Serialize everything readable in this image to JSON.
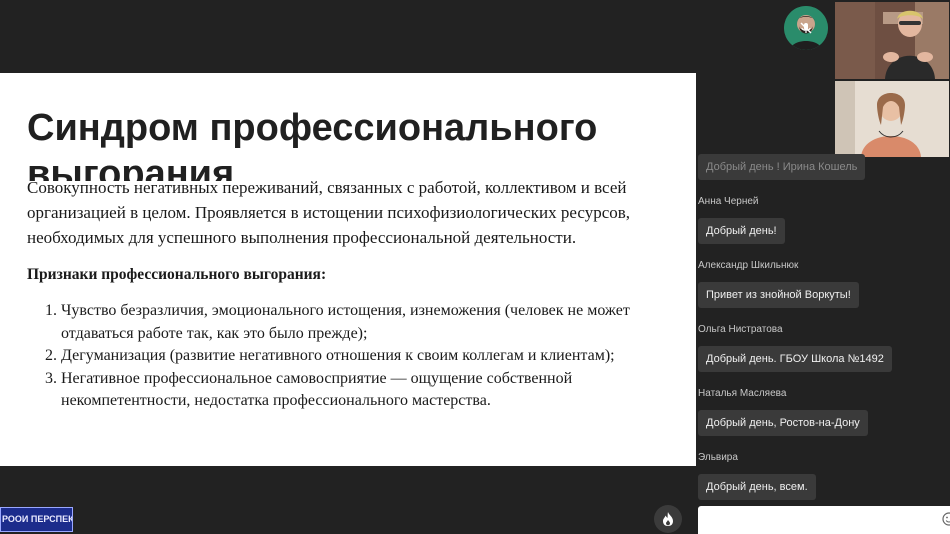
{
  "slide": {
    "title_line1": "Синдром профессионального",
    "title_line2": "выгорания",
    "paragraph": "Совокупность негативных переживаний, связанных с работой, коллективом и всей организацией в целом. Проявляется в истощении психофизиологических ресурсов, необходимых для успешного выполнения профессиональной деятельности.",
    "signs_heading": "Признаки профессионального выгорания:",
    "signs": [
      "Чувство безразличия, эмоционального истощения, изнеможения (человек не может отдаваться работе так, как это было прежде);",
      "Дегуманизация (развитие негативного отношения к своим коллегам и клиентам);",
      "Негативное профессиональное самовосприятие — ощущение собственной некомпетентности, недостатка профессионального мастерства."
    ]
  },
  "logo": {
    "text": "РООИ ПЕРСПЕКТИВА"
  },
  "chat": {
    "messages": [
      {
        "sender": "",
        "text": "Добрый день ! Ирина Кошель"
      },
      {
        "sender": "Анна Черней",
        "text": "Добрый день!"
      },
      {
        "sender": "Александр Шкильнюк",
        "text": "Привет из знойной Воркуты!"
      },
      {
        "sender": "Ольга Нистратова",
        "text": "Добрый день. ГБОУ Школа №1492"
      },
      {
        "sender": "Наталья Масляева",
        "text": "Добрый день, Ростов-на-Дону"
      },
      {
        "sender": "Эльвира",
        "text": "Добрый день,  всем."
      }
    ],
    "input_value": ""
  },
  "colors": {
    "background": "#222222",
    "slide": "#ffffff",
    "bubble": "#3a3a3a",
    "avatar": "#2a8c6b"
  },
  "icons": {
    "fire": "fire-icon",
    "mute": "muted-mic-icon",
    "emoji": "emoji-icon"
  }
}
